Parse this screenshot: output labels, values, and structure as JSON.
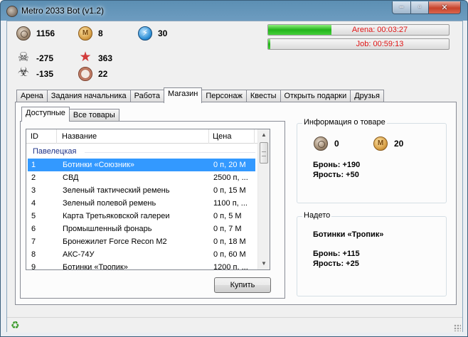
{
  "window": {
    "title": "Metro 2033 Bot (v1.2)"
  },
  "controls": {
    "minimize": "–",
    "maximize": "▫",
    "close": "✕"
  },
  "stats": {
    "silver": "1156",
    "gold": "8",
    "energy": "30",
    "kills": "-275",
    "stars": "363",
    "radiation": "-135",
    "rank": "22"
  },
  "timers": {
    "arena": {
      "text": "Arena: 00:03:27",
      "progress": 0.35
    },
    "job": {
      "text": "Job: 00:59:13",
      "progress": 0.01
    }
  },
  "tabs": [
    "Арена",
    "Задания начальника",
    "Работа",
    "Магазин",
    "Персонаж",
    "Квесты",
    "Открыть подарки",
    "Друзья"
  ],
  "active_tab": "Магазин",
  "subtabs": [
    "Доступные",
    "Все товары"
  ],
  "list": {
    "columns": {
      "id": "ID",
      "name": "Название",
      "price": "Цена"
    },
    "group": "Павелецкая",
    "rows": [
      {
        "id": "1",
        "name": "Ботинки «Союзник»",
        "price": "0 п, 20 М"
      },
      {
        "id": "2",
        "name": "СВД",
        "price": "2500 п, ..."
      },
      {
        "id": "3",
        "name": "Зеленый тактический ремень",
        "price": "0 п, 15 М"
      },
      {
        "id": "4",
        "name": "Зеленый полевой ремень",
        "price": "1100 п, ..."
      },
      {
        "id": "5",
        "name": "Карта Третьяковской галереи",
        "price": "0 п, 5 М"
      },
      {
        "id": "6",
        "name": "Промышленный фонарь",
        "price": "0 п, 7 М"
      },
      {
        "id": "7",
        "name": "Бронежилет Force Recon M2",
        "price": "0 п, 18 М"
      },
      {
        "id": "8",
        "name": "АКС-74У",
        "price": "0 п, 60 М"
      },
      {
        "id": "9",
        "name": "Ботинки «Тропик»",
        "price": "1200 п, ..."
      }
    ]
  },
  "buy_button": "Купить",
  "item_info": {
    "title": "Информация о товаре",
    "silver": "0",
    "gold": "20",
    "armor": "Бронь: +190",
    "rage": "Ярость: +50"
  },
  "equipped": {
    "title": "Надето",
    "name": "Ботинки «Тропик»",
    "armor": "Бронь: +115",
    "rage": "Ярость: +25"
  }
}
